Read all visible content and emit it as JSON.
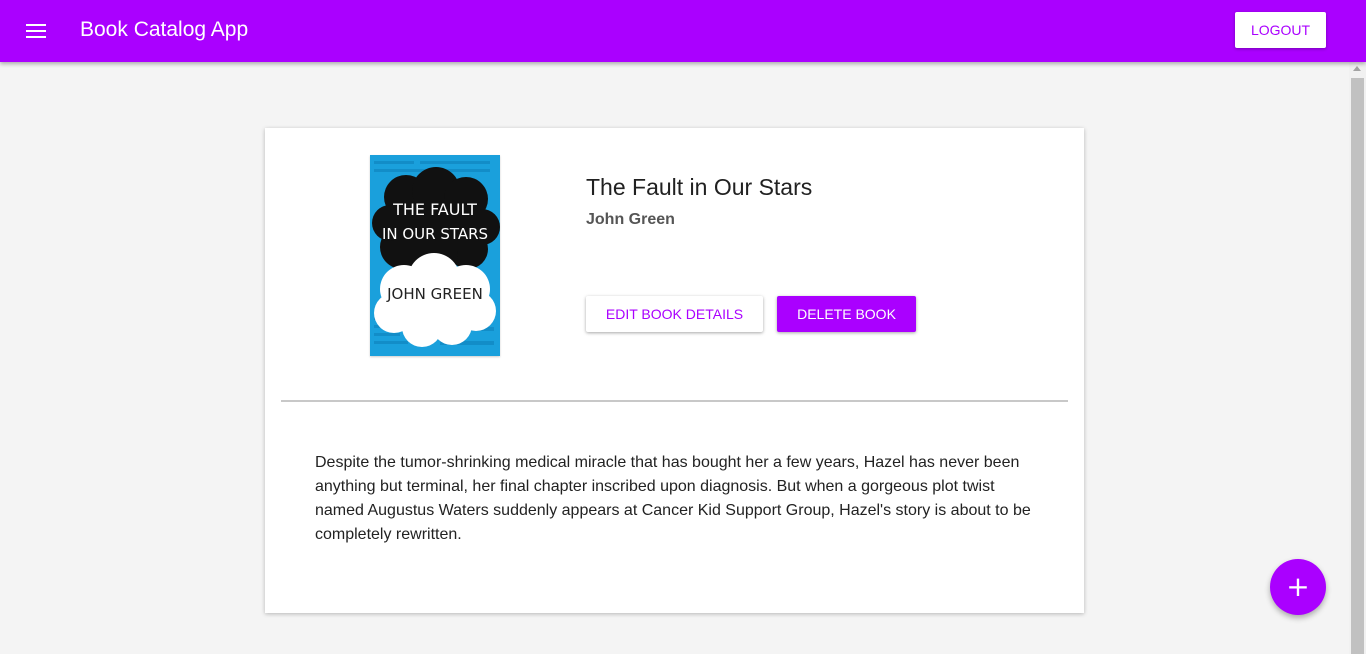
{
  "appbar": {
    "title": "Book Catalog App",
    "menu_icon": "hamburger-menu-icon",
    "logout_label": "LOGOUT",
    "color": "#aa00ff"
  },
  "book": {
    "title": "The Fault in Our Stars",
    "author": "John Green",
    "description": "Despite the tumor-shrinking medical miracle that has bought her a few years, Hazel has never been anything but terminal, her final chapter inscribed upon diagnosis. But when a gorgeous plot twist named Augustus Waters suddenly appears at Cancer Kid Support Group, Hazel's story is about to be completely rewritten.",
    "cover": {
      "title_line1": "THE FAULT",
      "title_line2": "IN OUR STARS",
      "author": "JOHN GREEN",
      "background_color": "#1aa0dc"
    }
  },
  "actions": {
    "edit_label": "EDIT BOOK DETAILS",
    "delete_label": "DELETE BOOK"
  },
  "fab": {
    "label": "+",
    "icon": "plus-icon"
  }
}
